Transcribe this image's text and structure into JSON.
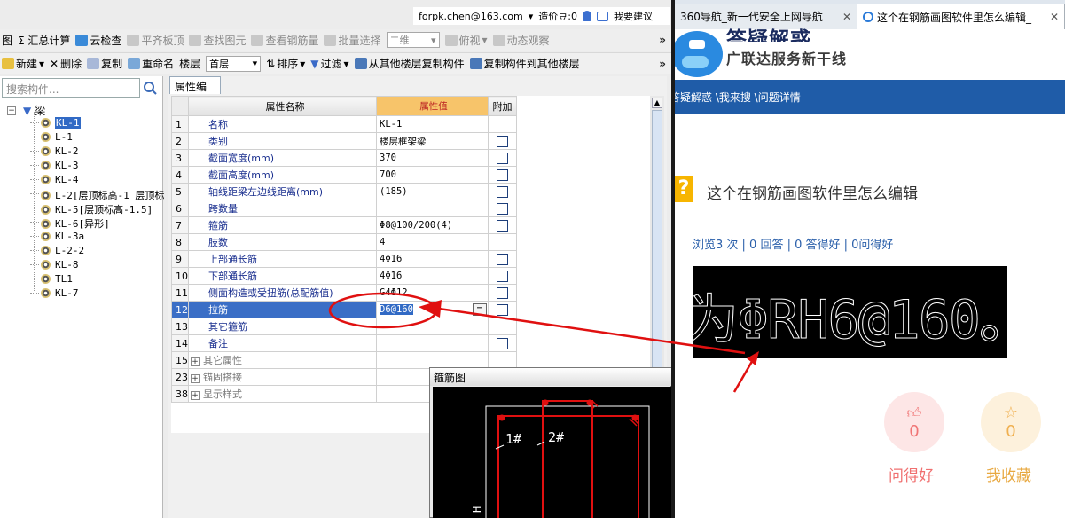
{
  "account": {
    "email": "forpk.chen@163.com",
    "beans": "造价豆:0",
    "suggest": "我要建议"
  },
  "toolbar1": [
    {
      "label": "图",
      "disabled": false
    },
    {
      "label": "Σ 汇总计算",
      "disabled": false
    },
    {
      "label": "云检查",
      "disabled": false
    },
    {
      "label": "平齐板顶",
      "disabled": true
    },
    {
      "label": "查找图元",
      "disabled": true
    },
    {
      "label": "查看钢筋量",
      "disabled": true
    },
    {
      "label": "批量选择",
      "disabled": true
    },
    {
      "label": "二维",
      "disabled": true
    },
    {
      "label": "俯视",
      "disabled": true
    },
    {
      "label": "动态观察",
      "disabled": true
    }
  ],
  "toolbar2": {
    "new": "新建",
    "delete": "删除",
    "copy": "复制",
    "rename": "重命名",
    "floor_label": "楼层",
    "floor_value": "首层",
    "sort": "排序",
    "filter": "过滤",
    "copy_from": "从其他楼层复制构件",
    "copy_to": "复制构件到其他楼层"
  },
  "tree": {
    "search_placeholder": "搜索构件...",
    "root": "梁",
    "items": [
      "KL-1",
      "L-1",
      "KL-2",
      "KL-3",
      "KL-4",
      "L-2[层顶标高-1 层顶标",
      "KL-5[层顶标高-1.5]",
      "KL-6[异形]",
      "KL-3a",
      "L-2-2",
      "KL-8",
      "TL1",
      "KL-7"
    ],
    "selected": "KL-1"
  },
  "props": {
    "tab": "属性编辑",
    "headers": {
      "name": "属性名称",
      "value": "属性值",
      "extra": "附加"
    },
    "rows": [
      {
        "n": "1",
        "name": "名称",
        "value": "KL-1",
        "cb": false
      },
      {
        "n": "2",
        "name": "类别",
        "value": "楼层框架梁",
        "cb": true
      },
      {
        "n": "3",
        "name": "截面宽度(mm)",
        "value": "370",
        "cb": true
      },
      {
        "n": "4",
        "name": "截面高度(mm)",
        "value": "700",
        "cb": true
      },
      {
        "n": "5",
        "name": "轴线距梁左边线距离(mm)",
        "value": "(185)",
        "cb": true
      },
      {
        "n": "6",
        "name": "跨数量",
        "value": "",
        "cb": true
      },
      {
        "n": "7",
        "name": "箍筋",
        "value": "Φ8@100/200(4)",
        "cb": true
      },
      {
        "n": "8",
        "name": "肢数",
        "value": "4",
        "cb": false
      },
      {
        "n": "9",
        "name": "上部通长筋",
        "value": "4Φ16",
        "cb": true
      },
      {
        "n": "10",
        "name": "下部通长筋",
        "value": "4Φ16",
        "cb": true
      },
      {
        "n": "11",
        "name": "侧面构造或受扭筋(总配筋值)",
        "value": "G4Φ12",
        "cb": true
      },
      {
        "n": "12",
        "name": "拉筋",
        "value": "D6@160",
        "cb": true,
        "current": true
      },
      {
        "n": "13",
        "name": "其它箍筋",
        "value": "",
        "cb": false
      },
      {
        "n": "14",
        "name": "备注",
        "value": "",
        "cb": true
      },
      {
        "n": "15",
        "name": "其它属性",
        "value": "",
        "cb": false,
        "group": true
      },
      {
        "n": "23",
        "name": "锚固搭接",
        "value": "",
        "cb": false,
        "group": true
      },
      {
        "n": "38",
        "name": "显示样式",
        "value": "",
        "cb": false,
        "group": true
      }
    ]
  },
  "stirrup": {
    "title": "箍筋图",
    "label1": "1#",
    "label2": "2#",
    "label_h": "H"
  },
  "browser": {
    "tab1": "360导航_新一代安全上网导航",
    "tab2": "这个在钢筋画图软件里怎么编辑_",
    "brand": "答疑解惑",
    "slogan": "广联达服务新干线",
    "nav": "答疑解惑 \\我来搜 \\问题详情",
    "question": "这个在钢筋画图软件里怎么编辑",
    "stats": "浏览3 次 | 0 回答 | 0 答得好 | 0问得好",
    "cad_text": "为ΦRH6@160。",
    "good_count": "0",
    "fav_count": "0",
    "good_label": "问得好",
    "fav_label": "我收藏"
  },
  "colors": {
    "accent": "#1f5ca8",
    "annotation": "#e01010",
    "selection": "#316ac5"
  }
}
